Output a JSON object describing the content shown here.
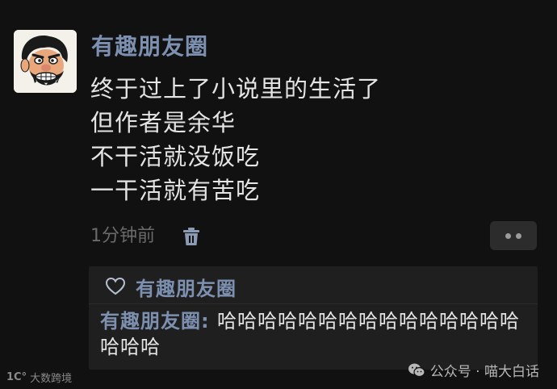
{
  "post": {
    "author": "有趣朋友圈",
    "lines": [
      "终于过上了小说里的生活了",
      "但作者是余华",
      "不干活就没饭吃",
      "一干活就有苦吃"
    ],
    "timestamp": "1分钟前"
  },
  "interactions": {
    "likes": [
      "有趣朋友圈"
    ],
    "comments": [
      {
        "author": "有趣朋友圈",
        "separator": ": ",
        "text": "哈哈哈哈哈哈哈哈哈哈哈哈哈哈哈哈哈哈"
      }
    ]
  },
  "watermarks": {
    "left_logo": "1C°",
    "left_text": "大数跨境",
    "right_text": "公众号 · 喵大白话"
  },
  "icons": {
    "avatar": "cartoon-avatar",
    "delete": "trash-icon",
    "more": "more-dots-icon",
    "like": "heart-icon",
    "watermark": "wechat-icon"
  },
  "colors": {
    "background": "#111111",
    "name": "#7d90b0",
    "text": "#e4e4e4",
    "muted": "#6a6a6a",
    "panel": "#1f1f1f"
  }
}
